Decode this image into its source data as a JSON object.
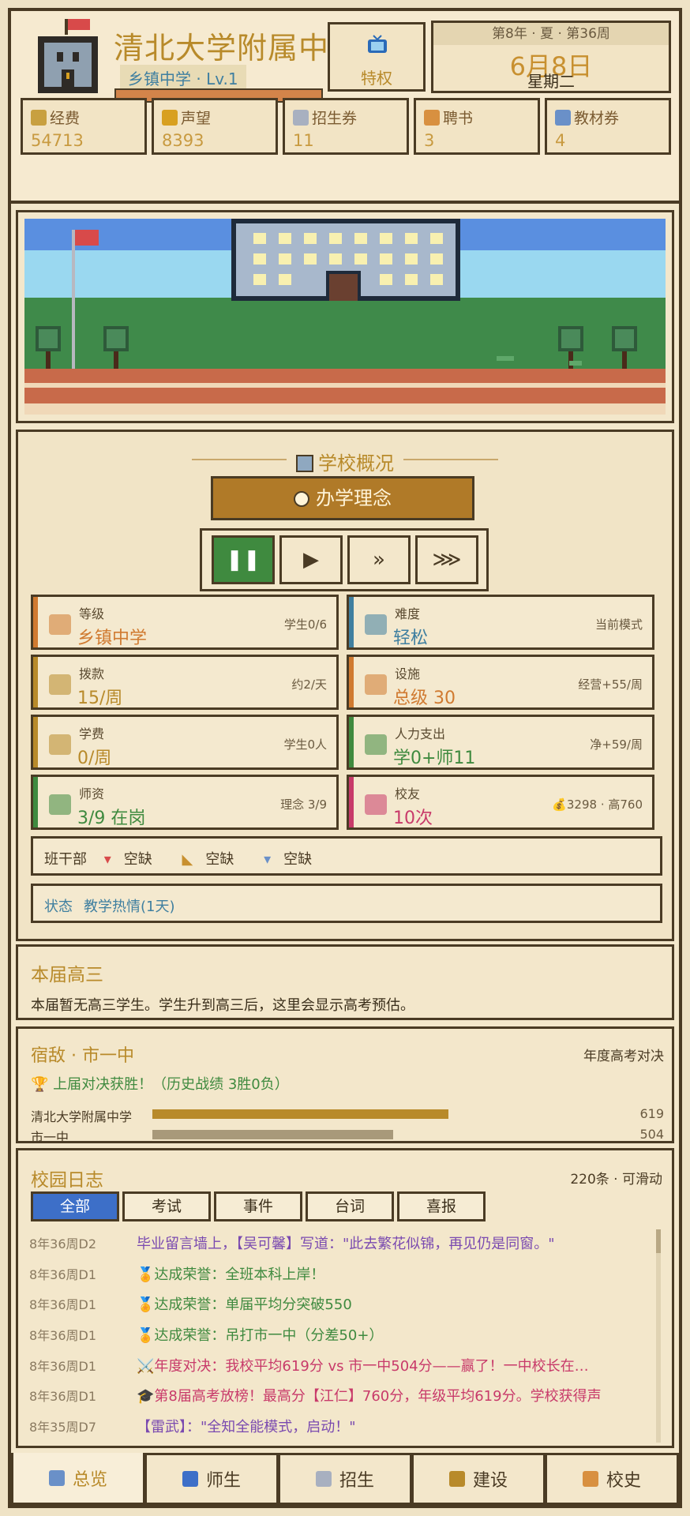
{
  "header": {
    "school_name": "清北大学附属中学",
    "school_level": "乡镇中学 · Lv.1",
    "privilege_label": "特权",
    "date_top": "第8年 · 夏 · 第36周",
    "date": "6月8日",
    "weekday": "星期二"
  },
  "resources": [
    {
      "name": "经费",
      "value": "54713",
      "icon": "money-bag-icon",
      "color": "#c8a040"
    },
    {
      "name": "声望",
      "value": "8393",
      "icon": "trophy-icon",
      "color": "#d8a020"
    },
    {
      "name": "招生券",
      "value": "11",
      "icon": "ticket-icon",
      "color": "#a8b0c0"
    },
    {
      "name": "聘书",
      "value": "3",
      "icon": "scroll-icon",
      "color": "#d89040"
    },
    {
      "name": "教材券",
      "value": "4",
      "icon": "books-icon",
      "color": "#6a90c8"
    }
  ],
  "overview": {
    "title": "学校概况",
    "philosophy_button": "办学理念",
    "speed_buttons": [
      "❚❚",
      "▶",
      "»",
      "⋙"
    ],
    "active_speed": 0,
    "stats": [
      {
        "label": "等级",
        "value": "乡镇中学",
        "right": "学生0/6",
        "value_color": "#d07a30",
        "bar_color": "#d07a30",
        "icon": "bank-icon"
      },
      {
        "label": "难度",
        "value": "轻松",
        "right": "当前模式",
        "value_color": "#3f7fa0",
        "bar_color": "#3f7fa0",
        "icon": "target-icon"
      },
      {
        "label": "拨款",
        "value": "15/周",
        "right": "约2/天",
        "value_color": "#b88a2a",
        "bar_color": "#b88a2a",
        "icon": "money-bag-icon"
      },
      {
        "label": "设施",
        "value": "总级 30",
        "right": "经营+55/周",
        "value_color": "#d07a30",
        "bar_color": "#d07a30",
        "icon": "crane-icon"
      },
      {
        "label": "学费",
        "value": "0/周",
        "right": "学生0人",
        "value_color": "#b88a2a",
        "bar_color": "#b88a2a",
        "icon": "banknote-icon"
      },
      {
        "label": "人力支出",
        "value": "学0+师11",
        "right": "净+59/周",
        "value_color": "#3f8a3f",
        "bar_color": "#3f8a3f",
        "icon": "chart-down-icon"
      },
      {
        "label": "师资",
        "value": "3/9 在岗",
        "right": "理念 3/9",
        "value_color": "#3f8a3f",
        "bar_color": "#3f8a3f",
        "icon": "teacher-icon"
      },
      {
        "label": "校友",
        "value": "10次",
        "right": "💰3298 · 高760",
        "value_color": "#c83a6a",
        "bar_color": "#c83a6a",
        "icon": "gift-icon"
      }
    ],
    "officers_label": "班干部",
    "officers": [
      "空缺",
      "空缺",
      "空缺"
    ],
    "status_label": "状态",
    "status_value": "教学热情(1天)"
  },
  "senior": {
    "title": "本届高三",
    "desc": "本届暂无高三学生。学生升到高三后，这里会显示高考预估。"
  },
  "rival": {
    "title": "宿敌 · 市一中",
    "right": "年度高考对决",
    "result": "🏆 上届对决获胜！（历史战绩 3胜0负）",
    "rows": [
      {
        "name": "清北大学附属中学",
        "score": 619,
        "color": "#b88a2a"
      },
      {
        "name": "市一中",
        "score": 504,
        "color": "#a8997a"
      }
    ],
    "max_score": 750
  },
  "log": {
    "title": "校园日志",
    "count": "220条 · 可滑动",
    "tabs": [
      "全部",
      "考试",
      "事件",
      "台词",
      "喜报"
    ],
    "active_tab": 0,
    "entries": [
      {
        "when": "8年36周D2",
        "text": "毕业留言墙上，【吴可馨】写道：\"此去繁花似锦，再见仍是同窗。\"",
        "color": "#7a4ab0"
      },
      {
        "when": "8年36周D1",
        "text": "🏅达成荣誉：全班本科上岸！",
        "color": "#3f8a3f"
      },
      {
        "when": "8年36周D1",
        "text": "🏅达成荣誉：单届平均分突破550",
        "color": "#3f8a3f"
      },
      {
        "when": "8年36周D1",
        "text": "🏅达成荣誉：吊打市一中（分差50+）",
        "color": "#3f8a3f"
      },
      {
        "when": "8年36周D1",
        "text": "⚔️年度对决：我校平均619分 vs 市一中504分——赢了！一中校长在…",
        "color": "#c83a6a"
      },
      {
        "when": "8年36周D1",
        "text": "🎓第8届高考放榜！最高分【江仁】760分，年级平均619分。学校获得声",
        "color": "#c83a6a"
      },
      {
        "when": "8年35周D7",
        "text": "【雷武】：\"全知全能模式，启动！\"",
        "color": "#7a4ab0"
      }
    ]
  },
  "nav": [
    {
      "label": "总览",
      "icon": "school-icon"
    },
    {
      "label": "师生",
      "icon": "people-icon"
    },
    {
      "label": "招生",
      "icon": "ticket-icon"
    },
    {
      "label": "建设",
      "icon": "hammer-icon"
    },
    {
      "label": "校史",
      "icon": "scroll-icon"
    }
  ],
  "active_nav": 0
}
